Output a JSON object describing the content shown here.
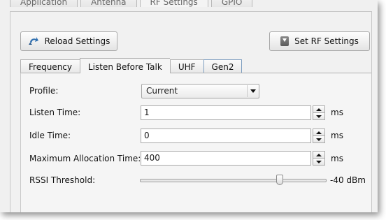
{
  "top_tabs": [
    {
      "label": "Application"
    },
    {
      "label": "Antenna"
    },
    {
      "label": "RF Settings"
    },
    {
      "label": "GPIO"
    }
  ],
  "toolbar": {
    "reload_label": "Reload Settings",
    "set_rf_label": "Set RF Settings"
  },
  "sub_tabs": [
    {
      "label": "Frequency"
    },
    {
      "label": "Listen Before Talk"
    },
    {
      "label": "UHF"
    },
    {
      "label": "Gen2"
    }
  ],
  "form": {
    "profile_label": "Profile:",
    "profile_value": "Current",
    "listen_time_label": "Listen Time:",
    "listen_time_value": "1",
    "listen_time_unit": "ms",
    "idle_time_label": "Idle Time:",
    "idle_time_value": "0",
    "idle_time_unit": "ms",
    "max_alloc_label": "Maximum Allocation Time:",
    "max_alloc_value": "400",
    "max_alloc_unit": "ms",
    "rssi_label": "RSSI Threshold:",
    "rssi_value": "-40 dBm",
    "rssi_slider_fraction": 0.75
  },
  "colors": {
    "reload_icon": "#2f6fb0",
    "gen2_tab_border": "#7d9ec0"
  },
  "icons": {
    "reload": "reload-icon",
    "set_rf": "download-icon"
  }
}
